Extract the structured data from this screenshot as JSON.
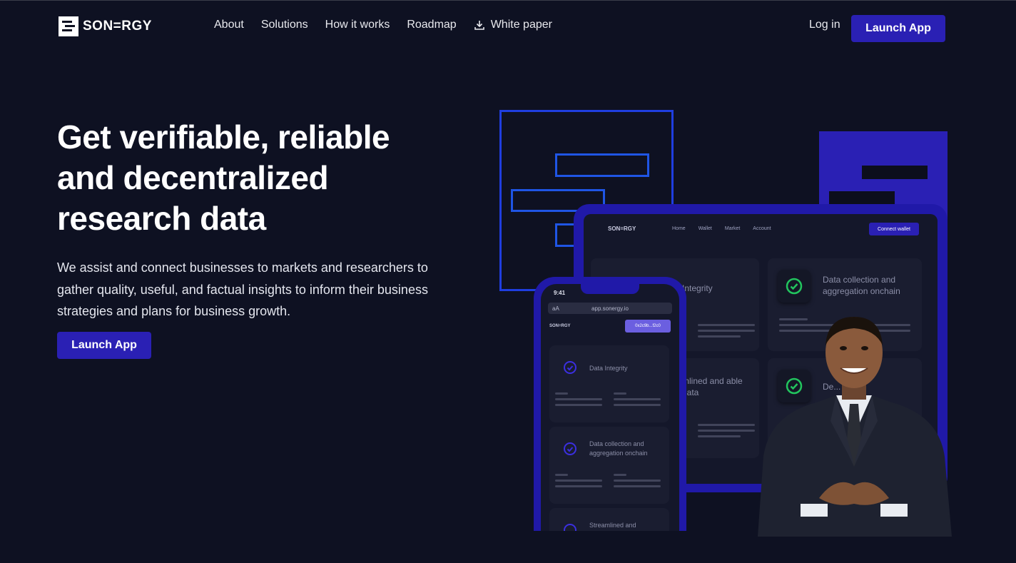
{
  "brand": {
    "name": "SON=RGY"
  },
  "nav": {
    "items": [
      "About",
      "Solutions",
      "How it works",
      "Roadmap"
    ],
    "white_paper": "White paper",
    "login": "Log in",
    "launch": "Launch App"
  },
  "hero": {
    "title_lines": [
      "Get verifiable, reliable",
      "and decentralized",
      "research data"
    ],
    "description": "We assist and connect businesses to markets and researchers to gather quality, useful, and factual insights to inform their business strategies and plans for business growth.",
    "launch": "Launch App"
  },
  "mockup": {
    "tablet": {
      "brand": "SON=RGY",
      "nav": [
        "Home",
        "Wallet",
        "Market",
        "Account"
      ],
      "connect": "Connect wallet",
      "cards": [
        "Integrity",
        "Data collection and aggregation onchain",
        "mlined and able data",
        "De... data"
      ]
    },
    "phone": {
      "time": "9:41",
      "url": "app.sonergy.io",
      "aA": "aA",
      "brand": "SON=RGY",
      "wallet": "0x2c9b...f2c0",
      "cards": [
        "Data Integrity",
        "Data collection and aggregation onchain",
        "Streamlined and"
      ]
    }
  },
  "colors": {
    "background": "#0e1122",
    "accent": "#2a20b4",
    "outline": "#1f3ee0",
    "check": "#22c55e"
  }
}
